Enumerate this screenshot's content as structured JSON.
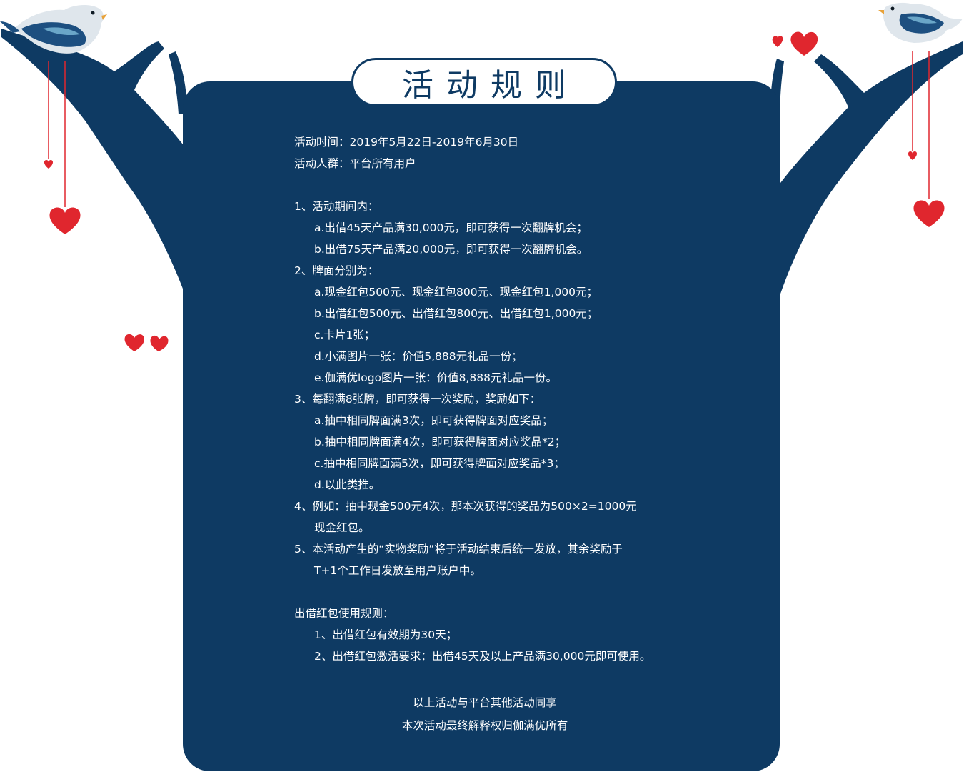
{
  "title": "活动规则",
  "colors": {
    "navy": "#0e3a63",
    "heart": "#e0262e",
    "white": "#ffffff",
    "bird_blue": "#6aa6c8"
  },
  "header": [
    "活动时间：2019年5月22日-2019年6月30日",
    "活动人群：平台所有用户"
  ],
  "sections": [
    {
      "heading": "1、活动期间内：",
      "items": [
        "a.出借45天产品满30,000元，即可获得一次翻牌机会；",
        "b.出借75天产品满20,000元，即可获得一次翻牌机会。"
      ]
    },
    {
      "heading": "2、牌面分别为：",
      "items": [
        "a.现金红包500元、现金红包800元、现金红包1,000元；",
        "b.出借红包500元、出借红包800元、出借红包1,000元；",
        "c.卡片1张；",
        "d.小满图片一张：价值5,888元礼品一份；",
        "e.伽满优logo图片一张：价值8,888元礼品一份。"
      ]
    },
    {
      "heading": "3、每翻满8张牌，即可获得一次奖励，奖励如下：",
      "items": [
        "a.抽中相同牌面满3次，即可获得牌面对应奖品；",
        "b.抽中相同牌面满4次，即可获得牌面对应奖品*2；",
        "c.抽中相同牌面满5次，即可获得牌面对应奖品*3；",
        "d.以此类推。"
      ]
    },
    {
      "heading": "4、例如：抽中现金500元4次，那本次获得的奖品为500×2=1000元",
      "items": [
        "现金红包。"
      ]
    },
    {
      "heading": "5、本活动产生的“实物奖励”将于活动结束后统一发放，其余奖励于",
      "items": [
        "T+1个工作日发放至用户账户中。"
      ]
    }
  ],
  "loan_rules": {
    "heading": "出借红包使用规则：",
    "items": [
      "1、出借红包有效期为30天；",
      "2、出借红包激活要求：出借45天及以上产品满30,000元即可使用。"
    ]
  },
  "footer": {
    "line1": "以上活动与平台其他活动同享",
    "line2": "本次活动最终解释权归伽满优所有"
  }
}
